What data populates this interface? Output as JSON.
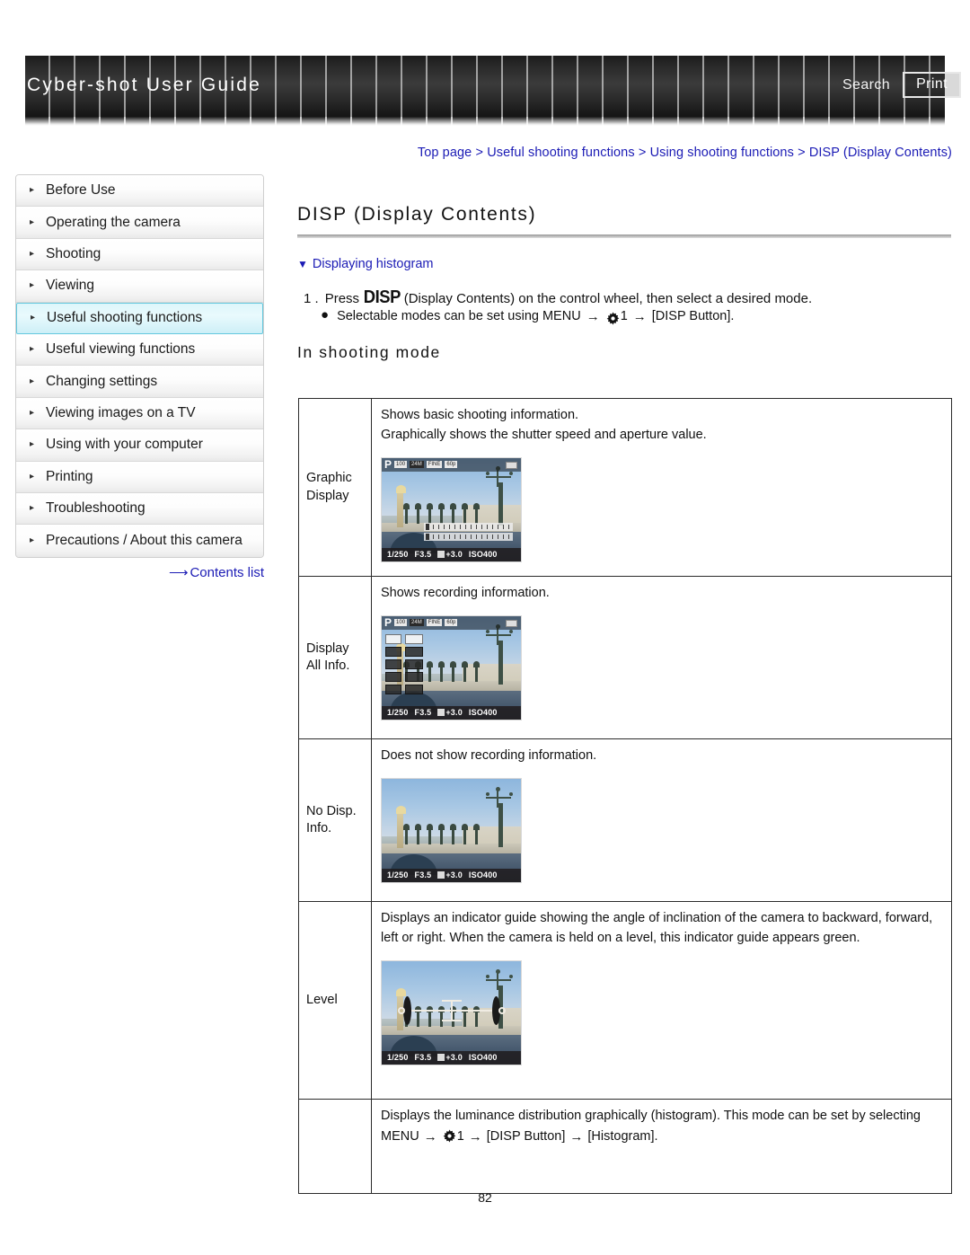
{
  "header": {
    "title": "Cyber-shot User Guide",
    "search_label": "Search",
    "print_label": "Print"
  },
  "breadcrumb": {
    "items": [
      "Top page",
      "Useful shooting functions",
      "Using shooting functions",
      "DISP (Display Contents)"
    ],
    "separator": ">",
    "full_text": "Top page > Useful shooting functions > Using shooting functions > DISP (Display Contents)"
  },
  "sidebar": {
    "items": [
      {
        "label": "Before Use",
        "active": false
      },
      {
        "label": "Operating the camera",
        "active": false
      },
      {
        "label": "Shooting",
        "active": false
      },
      {
        "label": "Viewing",
        "active": false
      },
      {
        "label": "Useful shooting functions",
        "active": true
      },
      {
        "label": "Useful viewing functions",
        "active": false
      },
      {
        "label": "Changing settings",
        "active": false
      },
      {
        "label": "Viewing images on a TV",
        "active": false
      },
      {
        "label": "Using with your computer",
        "active": false
      },
      {
        "label": "Printing",
        "active": false
      },
      {
        "label": "Troubleshooting",
        "active": false
      },
      {
        "label": "Precautions / About this camera",
        "active": false
      }
    ],
    "contents_link": "Contents list",
    "bullet_glyph": "▸",
    "arrow_glyph": "⟶"
  },
  "main": {
    "page_title": "DISP (Display Contents)",
    "sub_heading": "Displaying histogram",
    "sub_heading_triangle": "▼",
    "step": {
      "number": "1 .",
      "before_glyph": "Press",
      "glyph": "DISP",
      "after_glyph": "(Display Contents) on the control wheel, then select a desired mode."
    },
    "bullet": {
      "dot": "●",
      "part1": "Selectable modes can be set using MENU",
      "arrow": "→",
      "gear_number": "1",
      "part2": "[DISP Button]."
    },
    "mode_heading": "In shooting mode",
    "page_number": "82"
  },
  "table": {
    "rows": [
      {
        "label_lines": [
          "Graphic",
          "Display"
        ],
        "description_lines": [
          "Shows basic shooting information.",
          "Graphically shows the shutter speed and aperture value."
        ],
        "lcd_variant": "graphic"
      },
      {
        "label_lines": [
          "Display",
          "All Info."
        ],
        "description_lines": [
          "Shows recording information."
        ],
        "lcd_variant": "all-info"
      },
      {
        "label_lines": [
          "No Disp.",
          "Info."
        ],
        "description_lines": [
          "Does not show recording information."
        ],
        "lcd_variant": "no-info"
      },
      {
        "label_lines": [
          "Level"
        ],
        "description_lines": [
          "Displays an indicator guide showing the angle of inclination of the camera to backward, forward, left or right. When the camera is held on a level, this indicator guide appears green."
        ],
        "lcd_variant": "level"
      },
      {
        "label_lines": [],
        "description_histogram": {
          "part1": "Displays the luminance distribution graphically (histogram). This mode can be set by selecting MENU",
          "arrow": "→",
          "gear_number": "1",
          "part2": "[DISP Button]",
          "part3": "[Histogram]."
        },
        "lcd_variant": "none"
      }
    ]
  },
  "lcd": {
    "mode_letter": "P",
    "top_chips": [
      "100",
      "24M",
      "FINE",
      "60p"
    ],
    "shutter_speed": "1/250",
    "aperture": "F3.5",
    "exposure_comp": "+3.0",
    "iso": "ISO400"
  },
  "colors": {
    "link": "#1b1bb5",
    "active_sidebar_bg": "#ddf6fb",
    "active_sidebar_border": "#63c8de",
    "header_dark": "#2a2a2a",
    "table_border": "#2b2b2b"
  }
}
